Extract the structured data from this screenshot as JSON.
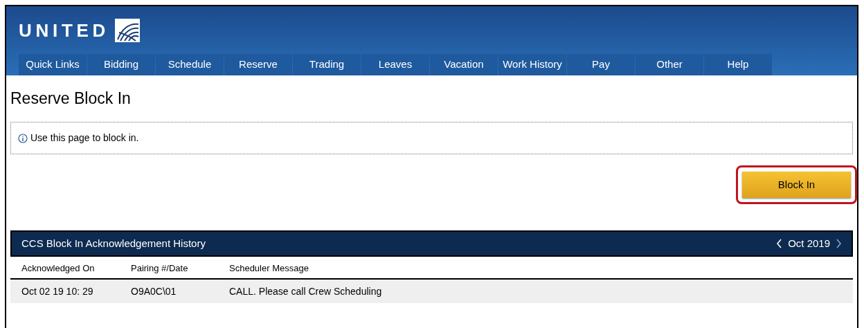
{
  "header": {
    "logo": "UNITED"
  },
  "nav": [
    {
      "label": "Quick Links"
    },
    {
      "label": "Bidding"
    },
    {
      "label": "Schedule"
    },
    {
      "label": "Reserve"
    },
    {
      "label": "Trading"
    },
    {
      "label": "Leaves"
    },
    {
      "label": "Vacation"
    },
    {
      "label": "Work History"
    },
    {
      "label": "Pay"
    },
    {
      "label": "Other"
    },
    {
      "label": "Help"
    }
  ],
  "page_title": "Reserve Block In",
  "info": "Use this page to block in.",
  "block_in_button": {
    "label": "Block In",
    "highlighted": true
  },
  "history": {
    "title": "CCS Block In Acknowledgement History",
    "month": "Oct 2019",
    "columns": [
      "Acknowledged On",
      "Pairing #/Date",
      "Scheduler Message"
    ],
    "rows": [
      [
        "Oct 02 19 10: 29",
        "O9A0C\\01",
        "CALL. Please call Crew Scheduling"
      ]
    ]
  }
}
